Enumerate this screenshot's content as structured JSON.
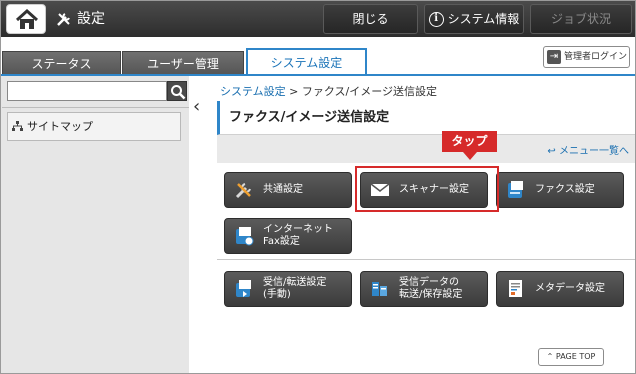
{
  "header": {
    "title": "設定",
    "close_label": "閉じる",
    "system_info_label": "システム情報",
    "job_status_label": "ジョブ状況"
  },
  "tabs": {
    "status": "ステータス",
    "user_management": "ユーザー管理",
    "system_settings": "システム設定"
  },
  "admin_login_label": "管理者ログイン",
  "sidebar": {
    "search_placeholder": "",
    "sitemap_label": "サイトマップ"
  },
  "breadcrumb": {
    "root": "システム設定",
    "separator": ">",
    "current": "ファクス/イメージ送信設定"
  },
  "section_title": "ファクス/イメージ送信設定",
  "menu_list_link": "メニュー一覧へ",
  "callout": "タップ",
  "tiles": {
    "common": "共通設定",
    "scanner": "スキャナー設定",
    "fax": "ファクス設定",
    "internet_fax_line1": "インターネット",
    "internet_fax_line2": "Fax設定",
    "receive_line1": "受信/転送設定",
    "receive_line2": "(手動)",
    "data_line1": "受信データの",
    "data_line2": "転送/保存設定",
    "metadata": "メタデータ設定"
  },
  "page_top_label": "PAGE TOP",
  "colors": {
    "accent": "#2f86c9",
    "highlight": "#d62a2a",
    "tile": "#4a4a4a"
  }
}
